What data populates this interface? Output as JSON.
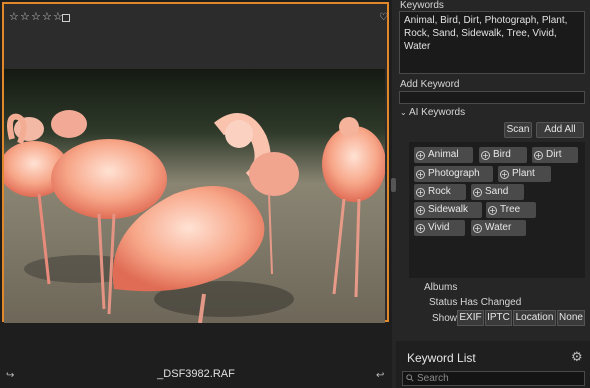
{
  "image_panel": {
    "rating_stars": [
      "☆",
      "☆",
      "☆",
      "☆",
      "☆"
    ],
    "filename": "_DSF3982.RAF",
    "accent_color": "#e0882a"
  },
  "keywords_panel": {
    "keywords_label": "Keywords",
    "keywords_text": "Animal, Bird, Dirt, Photograph, Plant, Rock, Sand, Sidewalk, Tree, Vivid, Water",
    "add_keyword_label": "Add Keyword",
    "add_keyword_value": "",
    "ai_keywords_label": "AI Keywords",
    "scan_label": "Scan",
    "add_all_label": "Add All",
    "ai_keywords": [
      "Animal",
      "Bird",
      "Dirt",
      "Photograph",
      "Plant",
      "Rock",
      "Sand",
      "Sidewalk",
      "Tree",
      "Vivid",
      "Water"
    ],
    "albums_label": "Albums",
    "status_label": "Status Has Changed",
    "show_label": "Show",
    "show_options": [
      "EXIF",
      "IPTC",
      "Location",
      "None"
    ]
  },
  "keyword_list": {
    "title": "Keyword List",
    "search_placeholder": "Search"
  }
}
